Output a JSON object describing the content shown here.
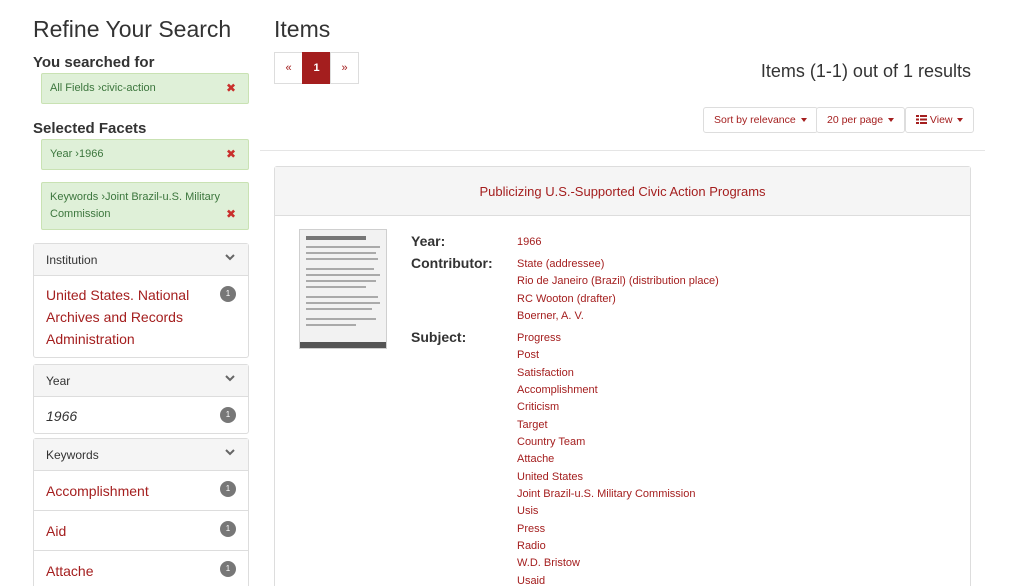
{
  "sidebar": {
    "title": "Refine Your Search",
    "searched_for": "You searched for",
    "search_constraint": {
      "field": "All Fields",
      "value": "civic-action"
    },
    "selected_facets": "Selected Facets",
    "facet_constraints": [
      {
        "field": "Year",
        "value": "1966"
      },
      {
        "field": "Keywords",
        "value": "Joint Brazil-u.S. Military Commission"
      }
    ],
    "facets": [
      {
        "name": "Institution",
        "items": [
          {
            "label": "United States. National Archives and Records Administration",
            "count": "1"
          }
        ]
      },
      {
        "name": "Year",
        "items": [
          {
            "label": "1966",
            "count": "1"
          }
        ]
      },
      {
        "name": "Keywords",
        "items": [
          {
            "label": "Accomplishment",
            "count": "1"
          },
          {
            "label": "Aid",
            "count": "1"
          },
          {
            "label": "Attache",
            "count": "1"
          }
        ]
      }
    ]
  },
  "main": {
    "title": "Items",
    "pager": {
      "prev": "«",
      "current": "1",
      "next": "»"
    },
    "results_text": "Items (1-1) out of 1 results",
    "sort_label": "Sort by relevance",
    "per_page_label": "20 per page",
    "view_label": "View",
    "document": {
      "title": "Publicizing U.S.-Supported Civic Action Programs",
      "year_label": "Year:",
      "year": "1966",
      "contributor_label": "Contributor:",
      "contributors": [
        "State (addressee)",
        "Rio de Janeiro (Brazil) (distribution place)",
        "RC Wooton (drafter)",
        "Boerner, A. V."
      ],
      "subject_label": "Subject:",
      "subjects": [
        "Progress",
        "Post",
        "Satisfaction",
        "Accomplishment",
        "Criticism",
        "Target",
        "Country Team",
        "Attache",
        "United States",
        "Joint Brazil-u.S. Military Commission",
        "Usis",
        "Press",
        "Radio",
        "W.D. Bristow",
        "Usaid"
      ]
    }
  },
  "colors": {
    "accent": "#a41e1e",
    "constraint_bg": "#dff0d8",
    "badge": "#777777"
  }
}
